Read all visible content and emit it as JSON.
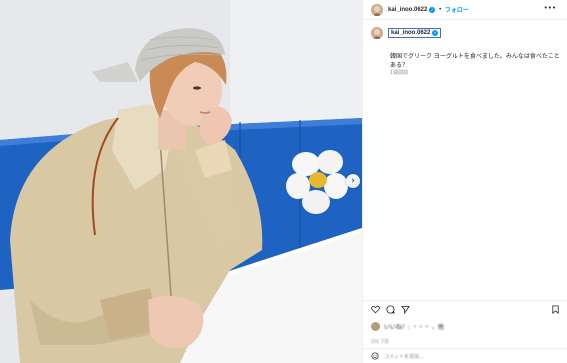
{
  "post": {
    "username": "kai_inoo.0622",
    "dot": "•",
    "follow_label": "フォロー",
    "more_label": "•••",
    "caption": "韓国でグリーク ヨーグルトを食べました。みんなは食べたことある？",
    "time_ago": "1週間前",
    "verified_mark": "✓"
  },
  "likes_row_text": "いいね！: ・・・ 、他",
  "date_text": "2月 7日",
  "comment_placeholder": "コメントを追加...",
  "next_arrow": "›",
  "icons": {
    "like": "heart-icon",
    "comment": "comment-icon",
    "share": "share-icon",
    "save": "bookmark-icon",
    "emoji": "emoji-icon",
    "next": "chevron-right-icon",
    "verified": "verified-badge-icon"
  },
  "colors": {
    "accent_blue": "#0095f6",
    "booth_blue": "#1f63c2",
    "highlight_box": "#3b6fd6"
  }
}
